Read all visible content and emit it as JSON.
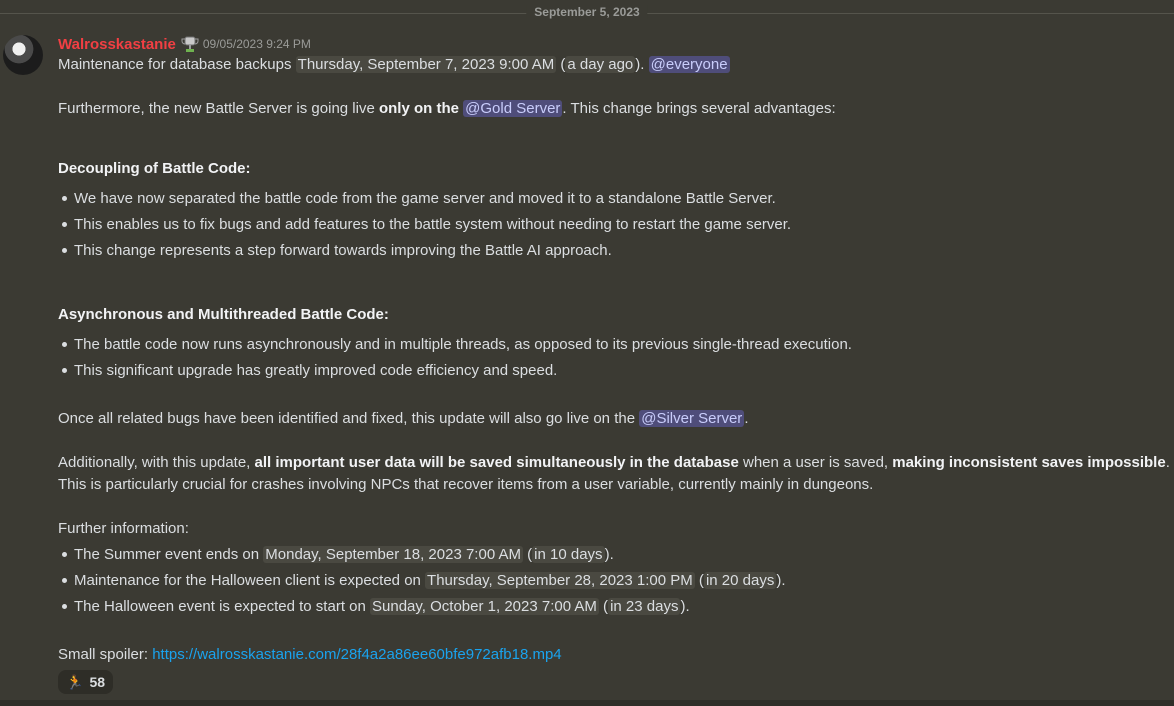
{
  "date_divider": "September 5, 2023",
  "message": {
    "username": "Walrosskastanie",
    "timestamp": "09/05/2023 9:24 PM",
    "badge_icon": "trophy-icon",
    "l1_text": "Maintenance for database backups",
    "l1_date": "Thursday, September 7, 2023 9:00 AM",
    "l1_rel": "a day ago",
    "l1_mention": "@everyone",
    "l2_pre": "Furthermore, the new Battle Server is going live",
    "l2_bold": "only on the",
    "l2_mention": "@Gold Server",
    "l2_post": ". This change brings several advantages:",
    "h1": "Decoupling of Battle Code:",
    "b1": [
      "We have now separated the battle code from the game server and moved it to a standalone Battle Server.",
      "This enables us to fix bugs and add features to the battle system without needing to restart the game server.",
      "This change represents a step forward towards improving the Battle AI approach."
    ],
    "h2": "Asynchronous and Multithreaded Battle Code:",
    "b2": [
      "The battle code now runs asynchronously and in multiple threads, as opposed to its previous single-thread execution.",
      "This significant upgrade has greatly improved code efficiency and speed."
    ],
    "l3_pre": "Once all related bugs have been identified and fixed, this update will also go live on the",
    "l3_mention": "@Silver Server",
    "l3_post": ".",
    "l4_pre": "Additionally, with this update,",
    "l4_bold1": "all important user data will be saved simultaneously in the database",
    "l4_mid": "when a user is saved,",
    "l4_bold2": "making inconsistent saves impossible",
    "l4_post": ".",
    "l5": "This is particularly crucial for crashes involving NPCs that recover items from a user variable, currently mainly in dungeons.",
    "further": "Further information:",
    "b3": [
      {
        "pre": "The Summer event ends on",
        "date": "Monday, September 18, 2023 7:00 AM",
        "rel": "in 10 days",
        "post": "."
      },
      {
        "pre": "Maintenance for the Halloween client is expected on",
        "date": "Thursday, September 28, 2023 1:00 PM",
        "rel": "in 20 days",
        "post": "."
      },
      {
        "pre": "The Halloween event is expected to start on",
        "date": "Sunday, October 1, 2023 7:00 AM",
        "rel": "in 23 days",
        "post": "."
      }
    ],
    "spoiler_label": "Small spoiler:",
    "spoiler_link": "https://walrosskastanie.com/28f4a2a86ee60bfe972afb18.mp4",
    "reaction": {
      "emoji": "🏃",
      "count": "58"
    }
  }
}
